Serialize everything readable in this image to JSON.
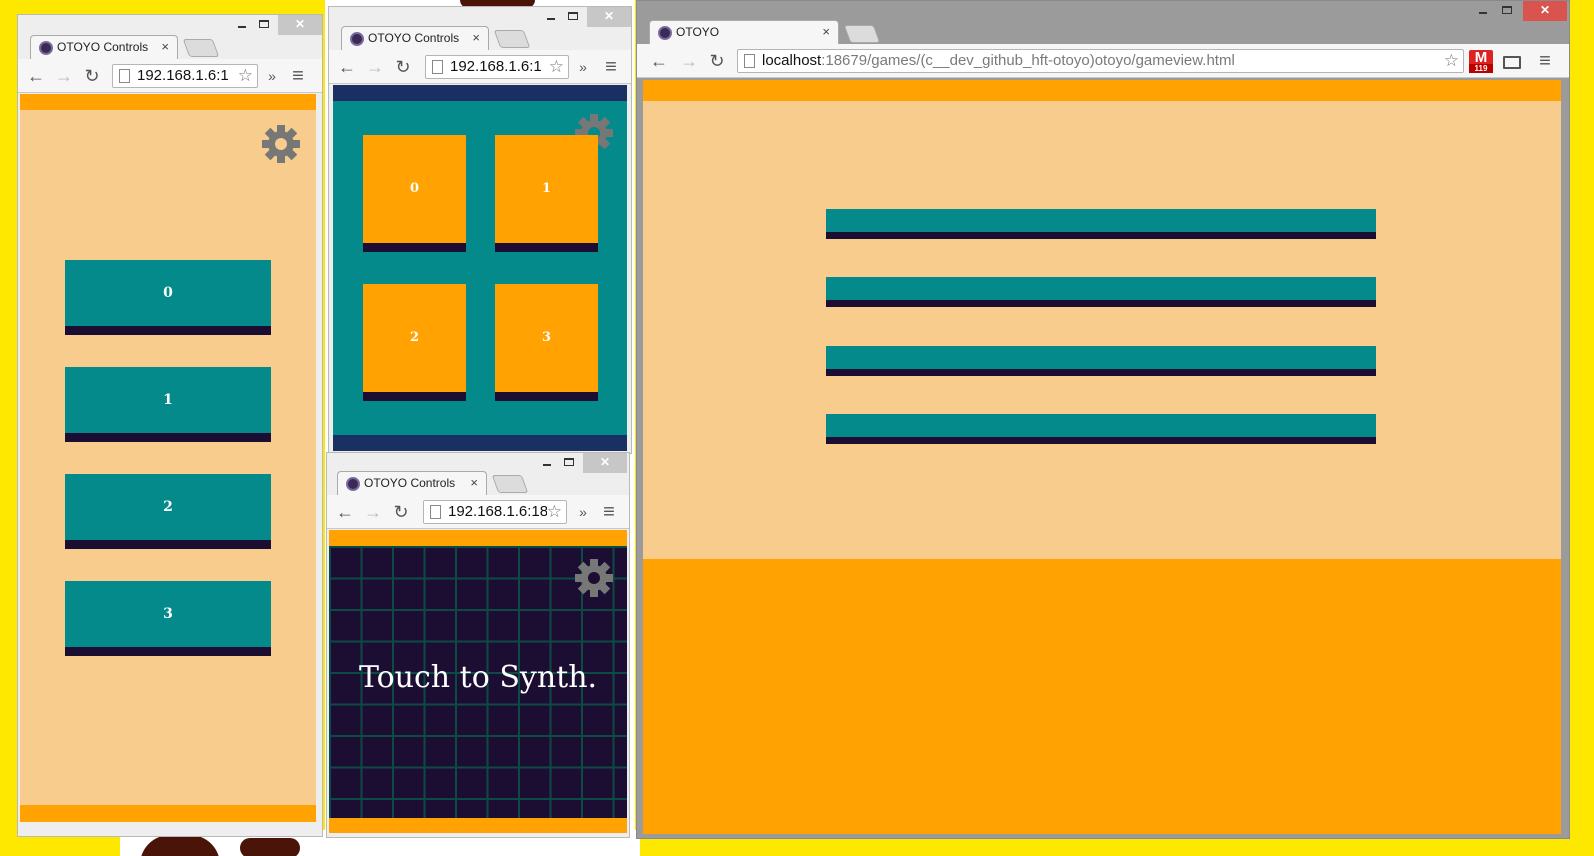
{
  "colors": {
    "desktop": "#ffe800",
    "peach": "#f7cc8d",
    "orange": "#ffa202",
    "teal": "#048a8a",
    "navy": "#1b3062",
    "dark_purple": "#1c0d32",
    "gear_gray": "#777777"
  },
  "windows": [
    {
      "tab_title": "OTOYO Controls",
      "url": "192.168.1.6:1",
      "buttons": [
        "0",
        "1",
        "2",
        "3"
      ],
      "settings_icon": "gear-icon"
    },
    {
      "tab_title": "OTOYO Controls",
      "url": "192.168.1.6:1",
      "buttons": [
        "0",
        "1",
        "2",
        "3"
      ],
      "settings_icon": "gear-icon"
    },
    {
      "tab_title": "OTOYO Controls",
      "url": "192.168.1.6:18",
      "message": "Touch to Synth.",
      "settings_icon": "gear-icon"
    },
    {
      "tab_title": "OTOYO",
      "url_host": "localhost",
      "url_rest": ":18679/games/(c__dev_github_hft-otoyo)otoyo/gameview.html",
      "extension_badge": "M",
      "extension_count": "119",
      "lane_count": 4
    }
  ],
  "icons": {
    "back": "←",
    "forward": "→",
    "reload": "↻",
    "star": "☆",
    "overflow": "»",
    "menu": "≡",
    "close_tab": "×",
    "window_close": "✕"
  }
}
